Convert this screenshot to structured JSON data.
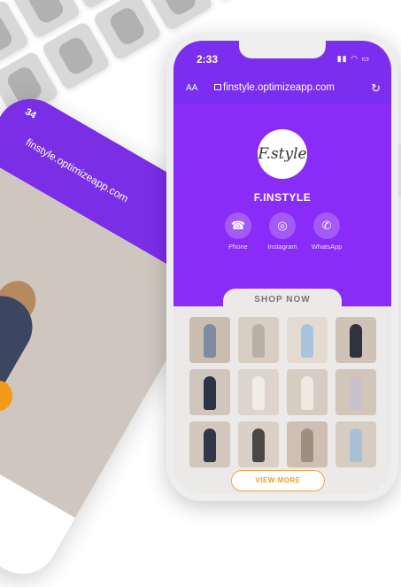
{
  "status": {
    "time": "2:33"
  },
  "browser": {
    "aa": "AA",
    "url": "finstyle.optimizeapp.com"
  },
  "profile": {
    "logo_text": "F.style",
    "brand": "F.INSTYLE"
  },
  "social": [
    {
      "label": "Phone",
      "icon": "phone-icon"
    },
    {
      "label": "Instagram",
      "icon": "instagram-icon"
    },
    {
      "label": "WhatsApp",
      "icon": "whatsapp-icon"
    }
  ],
  "shop": {
    "title": "SHOP NOW",
    "view_more": "VIEW MORE"
  },
  "products": [
    {
      "fill": "#c9bdb0",
      "fig": "#7f8ba0"
    },
    {
      "fill": "#d8cec4",
      "fig": "#b9b0a5"
    },
    {
      "fill": "#e3dbd2",
      "fig": "#a9c3dd"
    },
    {
      "fill": "#cfc3b8",
      "fig": "#2f3340"
    },
    {
      "fill": "#cfc6bd",
      "fig": "#2e3445"
    },
    {
      "fill": "#ddd5cc",
      "fig": "#f0ece6"
    },
    {
      "fill": "#d6ccc2",
      "fig": "#efe9e1"
    },
    {
      "fill": "#d2c6bb",
      "fig": "#c6c1cc"
    },
    {
      "fill": "#d1c7bd",
      "fig": "#303748"
    },
    {
      "fill": "#d9d0c7",
      "fig": "#4a4846"
    },
    {
      "fill": "#cdbfb1",
      "fig": "#9c8f80"
    },
    {
      "fill": "#d6ccc1",
      "fig": "#a8bfd6"
    }
  ],
  "left_phone": {
    "time": "34",
    "url": "finstyle.optimizeapp.com"
  },
  "colors": {
    "accent": "#8a2cf7",
    "orange": "#f29c3a"
  }
}
